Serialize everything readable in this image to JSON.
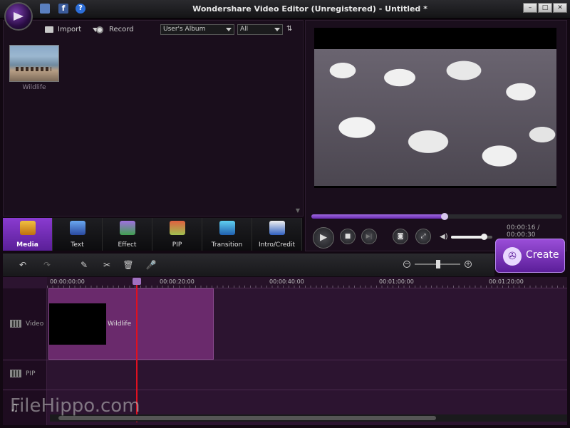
{
  "window": {
    "title": "Wondershare Video Editor (Unregistered) - Untitled *",
    "controls": [
      "–",
      "□",
      "✕"
    ]
  },
  "media": {
    "import_label": "Import",
    "record_label": "Record",
    "album_select": "User's Album",
    "filter_select": "All",
    "items": [
      {
        "label": "Wildlife"
      }
    ]
  },
  "tabs": [
    {
      "label": "Media",
      "icon": "media-icon",
      "active": true
    },
    {
      "label": "Text",
      "icon": "text-icon"
    },
    {
      "label": "Effect",
      "icon": "effect-icon"
    },
    {
      "label": "PIP",
      "icon": "pip-icon"
    },
    {
      "label": "Transition",
      "icon": "transition-icon"
    },
    {
      "label": "Intro/Credit",
      "icon": "intro-credit-icon"
    }
  ],
  "preview": {
    "timecode": "00:00:16 / 00:00:30",
    "progress": 0.53,
    "volume": 0.8
  },
  "create_label": "Create",
  "timeline": {
    "ruler_labels": [
      "00:00:00:00",
      "00:00:20:00",
      "00:00:40:00",
      "00:01:00:00",
      "00:01:20:00"
    ],
    "tracks": [
      {
        "label": "Video"
      },
      {
        "label": "PIP"
      }
    ],
    "clip_label": "Wildlife"
  },
  "watermark": "FileHippo.com",
  "colors": {
    "accent": "#7a35c0",
    "playhead": "#e01020"
  }
}
